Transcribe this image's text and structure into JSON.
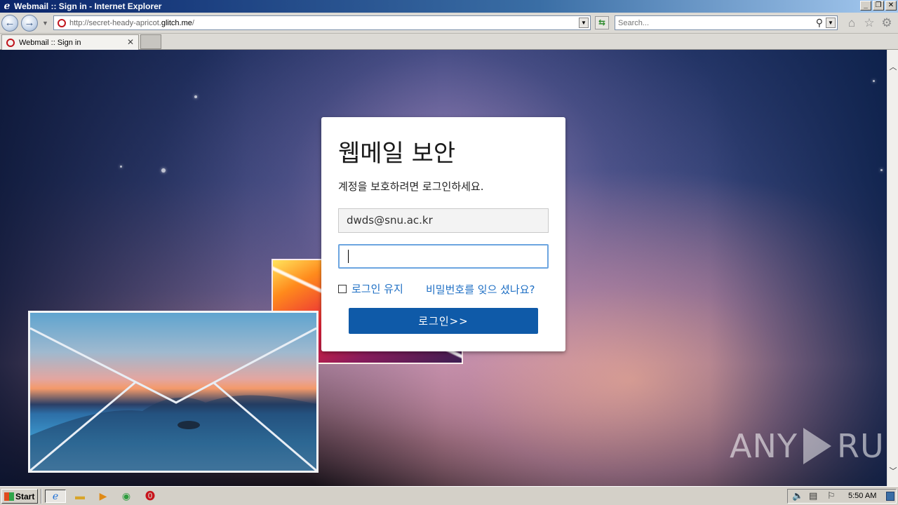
{
  "window": {
    "title": "Webmail :: Sign in - Internet Explorer",
    "address_prefix": "http://secret-heady-apricot.",
    "address_host": "glitch.me",
    "address_suffix": "/",
    "search_placeholder": "Search..."
  },
  "tab": {
    "label": "Webmail :: Sign in"
  },
  "login": {
    "title": "웹메일 보안",
    "subtitle": "계정을 보호하려면 로그인하세요.",
    "email_value": "dwds@snu.ac.kr",
    "password_value": "",
    "remember_label": "로그인 유지",
    "forgot_label": "비밀번호를 잊으 셨나요?",
    "submit_label": "로그인>>"
  },
  "watermark": {
    "left": "ANY",
    "right": "RUN"
  },
  "taskbar": {
    "start_label": "Start",
    "clock": "5:50 AM"
  },
  "icons": [
    "ie-icon",
    "back-icon",
    "forward-icon",
    "refresh-icon",
    "search-icon",
    "home-icon",
    "favorites-star-icon",
    "settings-gear-icon",
    "folder-icon",
    "media-player-icon",
    "chrome-icon",
    "stop-icon",
    "volume-icon",
    "network-icon",
    "flag-icon"
  ],
  "colors": {
    "accent": "#0f5aa8",
    "link": "#1e6fc4",
    "focus": "#6ca5e0"
  }
}
